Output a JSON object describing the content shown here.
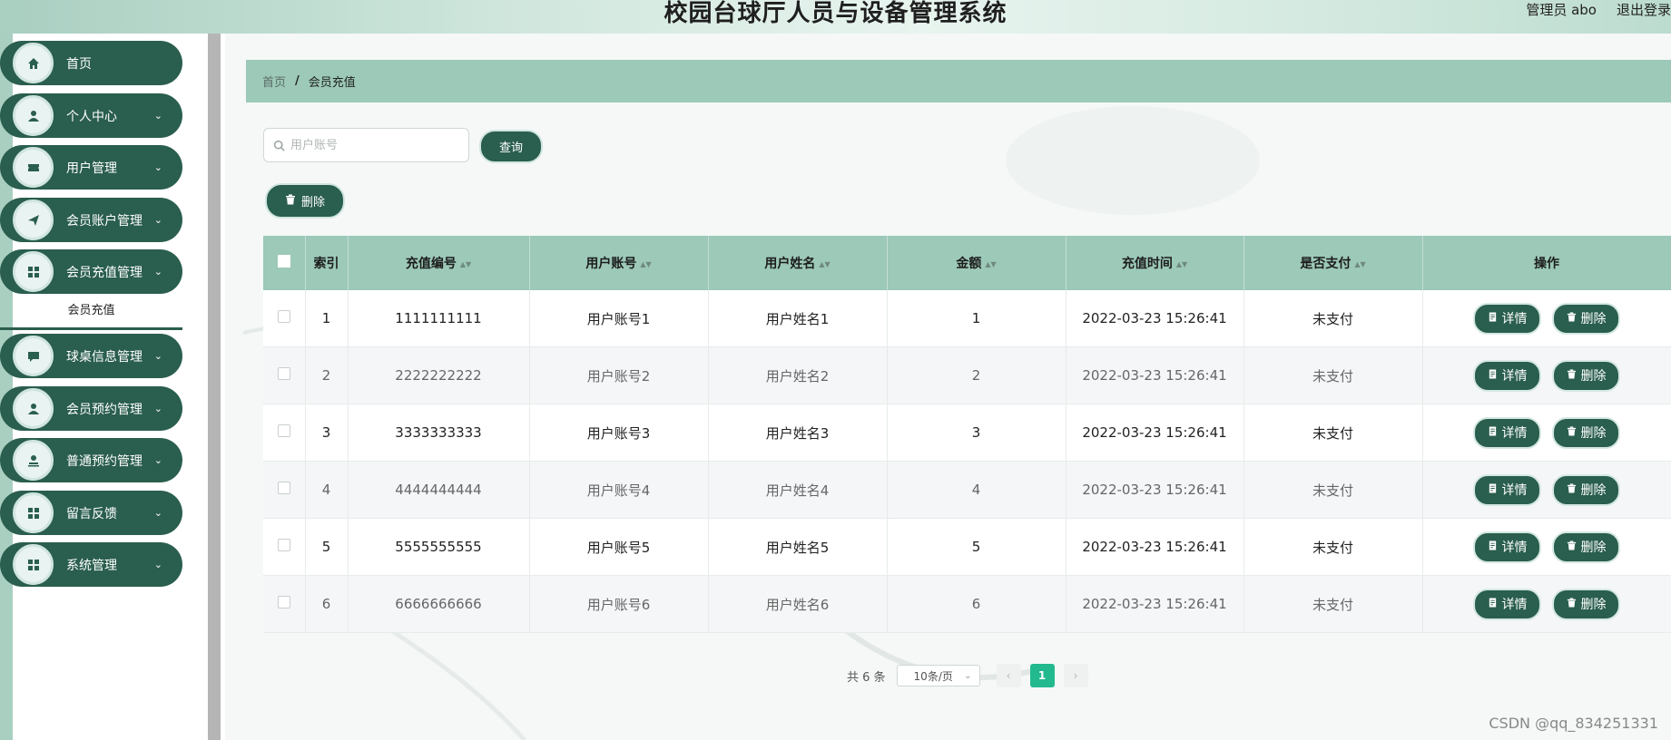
{
  "header": {
    "title": "校园台球厅人员与设备管理系统",
    "user": "管理员 abo",
    "logout": "退出登录"
  },
  "sidebar": {
    "items": [
      {
        "label": "首页",
        "icon": "home-icon",
        "chevron": ""
      },
      {
        "label": "个人中心",
        "icon": "user-icon",
        "chevron": "⌄"
      },
      {
        "label": "用户管理",
        "icon": "ticket-icon",
        "chevron": "⌄"
      },
      {
        "label": "会员账户管理",
        "icon": "send-icon",
        "chevron": "⌄"
      },
      {
        "label": "会员充值管理",
        "icon": "grid-icon",
        "chevron": "⌄"
      },
      {
        "label": "球桌信息管理",
        "icon": "chat-icon",
        "chevron": "⌄"
      },
      {
        "label": "会员预约管理",
        "icon": "user-icon",
        "chevron": "⌄"
      },
      {
        "label": "普通预约管理",
        "icon": "stamp-icon",
        "chevron": "⌄"
      },
      {
        "label": "留言反馈",
        "icon": "grid-icon",
        "chevron": "⌄"
      },
      {
        "label": "系统管理",
        "icon": "grid-icon",
        "chevron": "⌄"
      }
    ],
    "submenu": {
      "label": "会员充值"
    }
  },
  "breadcrumb": {
    "home": "首页",
    "separator": "/",
    "current": "会员充值"
  },
  "search": {
    "placeholder": "用户账号",
    "value": "",
    "button": "查询"
  },
  "toolbar": {
    "delete": "删除"
  },
  "table": {
    "columns": [
      "索引",
      "充值编号",
      "用户账号",
      "用户姓名",
      "金额",
      "充值时间",
      "是否支付",
      "操作"
    ],
    "rows": [
      {
        "index": "1",
        "id": "1111111111",
        "account": "用户账号1",
        "name": "用户姓名1",
        "amount": "1",
        "time": "2022-03-23 15:26:41",
        "paid": "未支付"
      },
      {
        "index": "2",
        "id": "2222222222",
        "account": "用户账号2",
        "name": "用户姓名2",
        "amount": "2",
        "time": "2022-03-23 15:26:41",
        "paid": "未支付"
      },
      {
        "index": "3",
        "id": "3333333333",
        "account": "用户账号3",
        "name": "用户姓名3",
        "amount": "3",
        "time": "2022-03-23 15:26:41",
        "paid": "未支付"
      },
      {
        "index": "4",
        "id": "4444444444",
        "account": "用户账号4",
        "name": "用户姓名4",
        "amount": "4",
        "time": "2022-03-23 15:26:41",
        "paid": "未支付"
      },
      {
        "index": "5",
        "id": "5555555555",
        "account": "用户账号5",
        "name": "用户姓名5",
        "amount": "5",
        "time": "2022-03-23 15:26:41",
        "paid": "未支付"
      },
      {
        "index": "6",
        "id": "6666666666",
        "account": "用户账号6",
        "name": "用户姓名6",
        "amount": "6",
        "time": "2022-03-23 15:26:41",
        "paid": "未支付"
      }
    ],
    "actions": {
      "detail": "详情",
      "delete": "删除"
    }
  },
  "pagination": {
    "total": "共 6 条",
    "page_size": "10条/页",
    "current": "1",
    "prev": "‹",
    "next": "›"
  },
  "watermark": "CSDN @qq_834251331",
  "colors": {
    "primary": "#2a5e4e",
    "header_bg": "#9cc9b8",
    "active_page": "#23b98e"
  }
}
